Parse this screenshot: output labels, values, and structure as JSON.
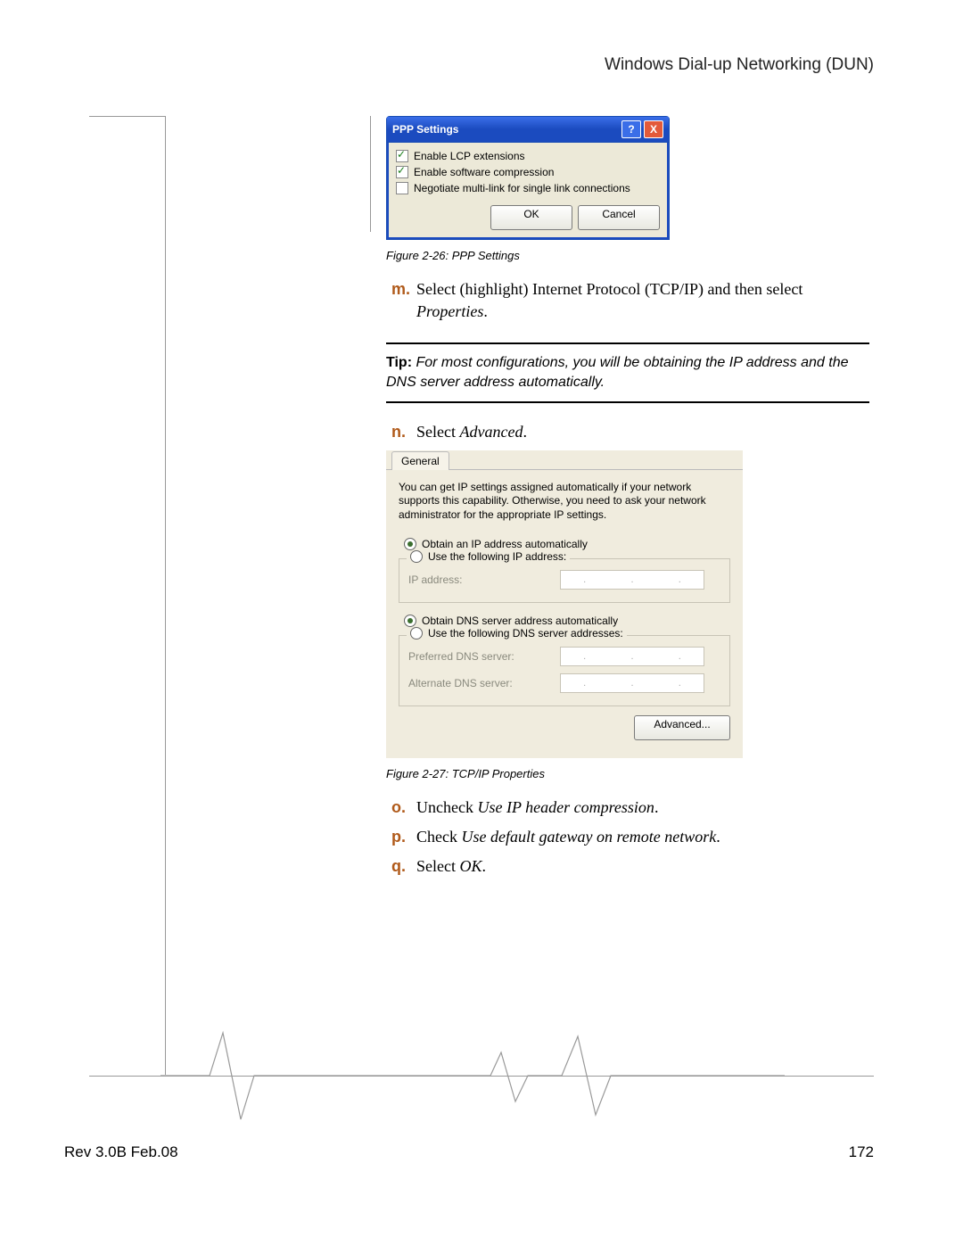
{
  "header": {
    "title": "Windows Dial-up Networking (DUN)"
  },
  "ppp_window": {
    "title": "PPP Settings",
    "checks": [
      {
        "label": "Enable LCP extensions",
        "checked": true
      },
      {
        "label": "Enable software compression",
        "checked": true
      },
      {
        "label": "Negotiate multi-link for single link connections",
        "checked": false
      }
    ],
    "ok": "OK",
    "cancel": "Cancel"
  },
  "caption1": "Figure 2-26: PPP Settings",
  "steps": {
    "m": {
      "letter": "m.",
      "text_pre": "Select (highlight) Internet Protocol (TCP/IP) and then select ",
      "italic": "Properties",
      "text_post": "."
    },
    "n": {
      "letter": "n.",
      "text_pre": "Select ",
      "italic": "Advanced",
      "text_post": "."
    },
    "o": {
      "letter": "o.",
      "text_pre": "Uncheck ",
      "italic": "Use IP header compression",
      "text_post": "."
    },
    "p": {
      "letter": "p.",
      "text_pre": "Check ",
      "italic": "Use default gateway on remote network",
      "text_post": "."
    },
    "q": {
      "letter": "q.",
      "text_pre": "Select ",
      "italic": "OK",
      "text_post": "."
    }
  },
  "tip": {
    "label": "Tip:",
    "text": " For most configurations, you will be obtaining the IP address and the DNS server address automatically."
  },
  "tcpip": {
    "tab": "General",
    "desc": "You can get IP settings assigned automatically if your network supports this capability. Otherwise, you need to ask your network administrator for the appropriate IP settings.",
    "r1": "Obtain an IP address automatically",
    "r2": "Use the following IP address:",
    "ip_label": "IP address:",
    "r3": "Obtain DNS server address automatically",
    "r4": "Use the following DNS server addresses:",
    "pref_dns": "Preferred DNS server:",
    "alt_dns": "Alternate DNS server:",
    "advanced": "Advanced..."
  },
  "caption2": "Figure 2-27: TCP/IP Properties",
  "footer": {
    "left": "Rev 3.0B Feb.08",
    "right": "172"
  }
}
